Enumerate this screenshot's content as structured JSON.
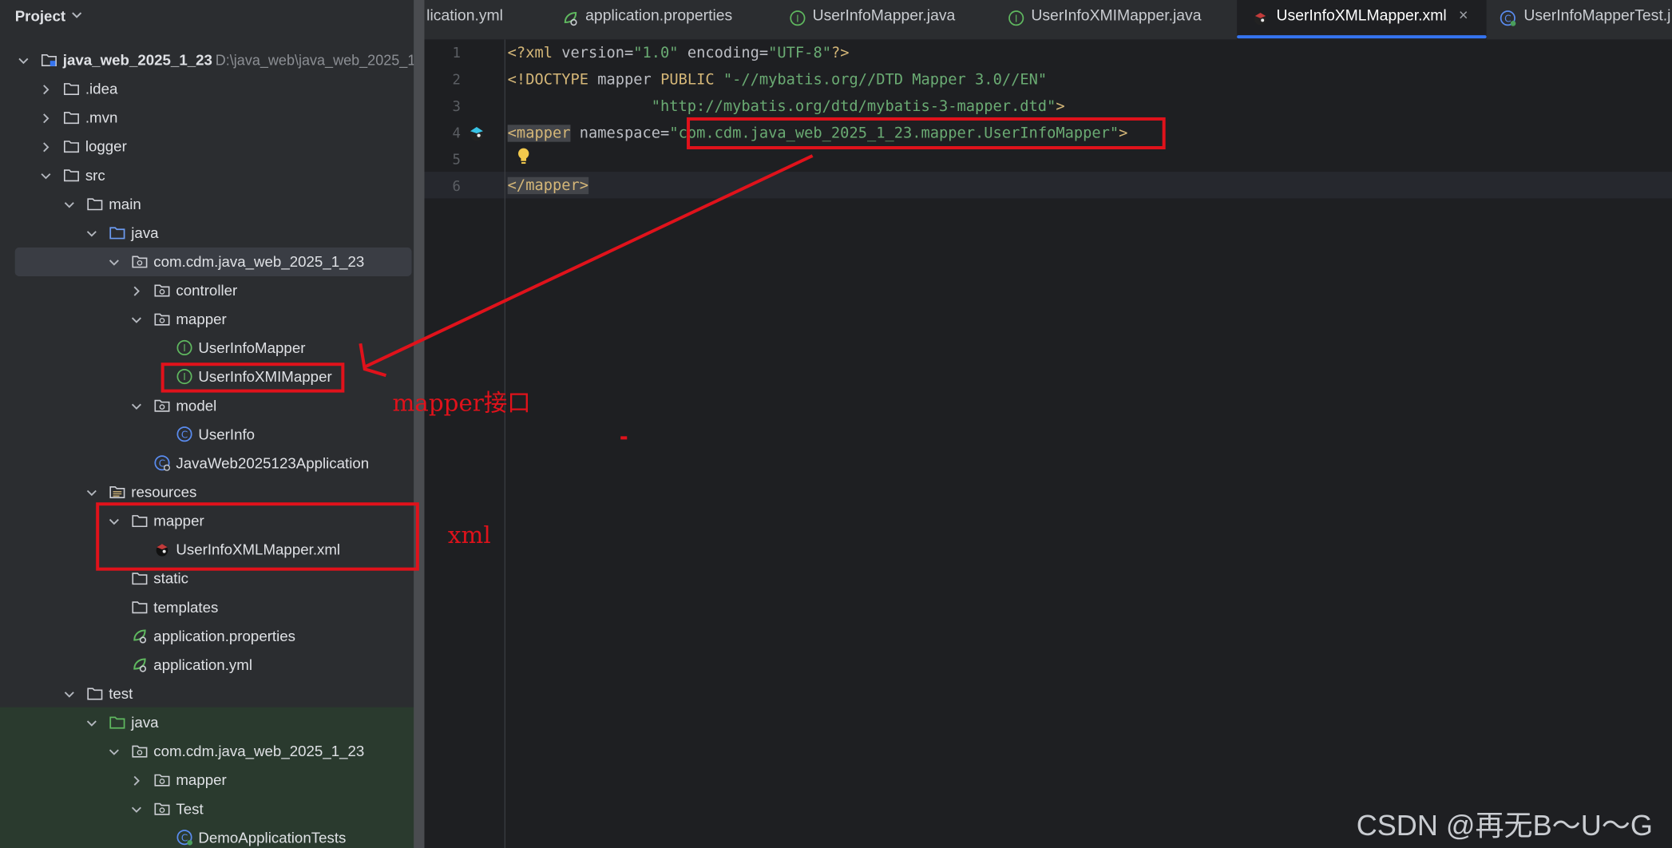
{
  "project": {
    "title": "Project",
    "tree": [
      {
        "label": "java_web_2025_1_23",
        "path": "D:\\java_web\\java_web_2025_1_",
        "icon": "module-folder-icon",
        "expanded": true,
        "bold": true
      },
      {
        "label": ".idea",
        "icon": "folder-icon",
        "expanded": false
      },
      {
        "label": ".mvn",
        "icon": "folder-icon",
        "expanded": false
      },
      {
        "label": "logger",
        "icon": "folder-icon",
        "expanded": false
      },
      {
        "label": "src",
        "icon": "folder-icon",
        "expanded": true
      },
      {
        "label": "main",
        "icon": "folder-icon",
        "expanded": true
      },
      {
        "label": "java",
        "icon": "source-root-folder-icon",
        "expanded": true
      },
      {
        "label": "com.cdm.java_web_2025_1_23",
        "icon": "package-icon",
        "expanded": true,
        "selected": true
      },
      {
        "label": "controller",
        "icon": "package-icon",
        "expanded": false
      },
      {
        "label": "mapper",
        "icon": "package-icon",
        "expanded": true
      },
      {
        "label": "UserInfoMapper",
        "icon": "interface-icon"
      },
      {
        "label": "UserInfoXMIMapper",
        "icon": "interface-icon"
      },
      {
        "label": "model",
        "icon": "package-icon",
        "expanded": true
      },
      {
        "label": "UserInfo",
        "icon": "class-icon"
      },
      {
        "label": "JavaWeb2025123Application",
        "icon": "spring-app-class-icon"
      },
      {
        "label": "resources",
        "icon": "resources-folder-icon",
        "expanded": true
      },
      {
        "label": "mapper",
        "icon": "folder-icon",
        "expanded": true
      },
      {
        "label": "UserInfoXMLMapper.xml",
        "icon": "mybatis-xml-icon"
      },
      {
        "label": "static",
        "icon": "folder-icon"
      },
      {
        "label": "templates",
        "icon": "folder-icon"
      },
      {
        "label": "application.properties",
        "icon": "spring-config-icon"
      },
      {
        "label": "application.yml",
        "icon": "spring-config-icon"
      },
      {
        "label": "test",
        "icon": "folder-icon",
        "expanded": true
      },
      {
        "label": "java",
        "icon": "test-root-folder-icon",
        "expanded": true
      },
      {
        "label": "com.cdm.java_web_2025_1_23",
        "icon": "package-icon",
        "expanded": true
      },
      {
        "label": "mapper",
        "icon": "package-icon",
        "expanded": false
      },
      {
        "label": "Test",
        "icon": "package-icon",
        "expanded": true
      },
      {
        "label": "DemoApplicationTests",
        "icon": "test-class-icon"
      }
    ]
  },
  "tabs": [
    {
      "label": "lication.yml",
      "icon": "spring-config-icon"
    },
    {
      "label": "application.properties",
      "icon": "spring-config-icon"
    },
    {
      "label": "UserInfoMapper.java",
      "icon": "interface-icon"
    },
    {
      "label": "UserInfoXMIMapper.java",
      "icon": "interface-icon"
    },
    {
      "label": "UserInfoXMLMapper.xml",
      "icon": "mybatis-xml-icon",
      "active": true,
      "close": "×"
    },
    {
      "label": "UserInfoMapperTest.j",
      "icon": "test-class-icon"
    }
  ],
  "editor": {
    "line_numbers": [
      "1",
      "2",
      "3",
      "4",
      "5",
      "6"
    ],
    "line1": {
      "open": "<?xml ",
      "a1": "version=",
      "v1": "\"1.0\"",
      "a2": " encoding=",
      "v2": "\"UTF-8\"",
      "close": "?>"
    },
    "line2": {
      "open": "<!DOCTYPE ",
      "a1": "mapper ",
      "k1": "PUBLIC ",
      "v1": "\"-//mybatis.org//DTD Mapper 3.0//EN\""
    },
    "line3": {
      "indent": "                ",
      "v1": "\"http://mybatis.org/dtd/mybatis-3-mapper.dtd\"",
      "close": ">"
    },
    "line4": {
      "open": "<mapper",
      "a1": " namespace=",
      "v1": "\"com.cdm.java_web_2025_1_23.mapper.UserInfoMapper\"",
      "close": ">"
    },
    "line6": {
      "tag": "</mapper>"
    }
  },
  "annotations": {
    "mapper_label": "mapper接口",
    "xml_label": "xml"
  },
  "watermark": "CSDN @再无B～U～G",
  "colors": {
    "annotation_red": "#e0121b",
    "accent_blue": "#3574f0",
    "test_bg": "#2a3a2e"
  }
}
